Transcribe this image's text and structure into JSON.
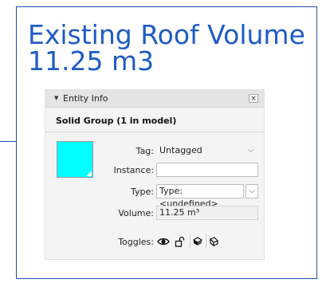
{
  "callout": {
    "title_line1": "Existing Roof Volume",
    "title_line2": "11.25 m3"
  },
  "entity_info": {
    "panel_title": "Entity Info",
    "close_symbol": "×",
    "expand_arrow": "▼",
    "entity_name": "Solid Group (1 in model)",
    "swatch_color": "#00ffff",
    "tag": {
      "label": "Tag:",
      "value": "Untagged"
    },
    "instance": {
      "label": "Instance:",
      "value": ""
    },
    "type": {
      "label": "Type:",
      "value": "Type: <undefined>"
    },
    "volume": {
      "label": "Volume:",
      "value": "11.25 m³"
    },
    "toggles": {
      "label": "Toggles:",
      "icons": [
        "eye-icon",
        "lock-icon",
        "cast-shadows-icon",
        "receive-shadows-icon"
      ]
    }
  },
  "colors": {
    "callout_border": "#1c4fb0",
    "callout_text": "#1e5bc6"
  }
}
